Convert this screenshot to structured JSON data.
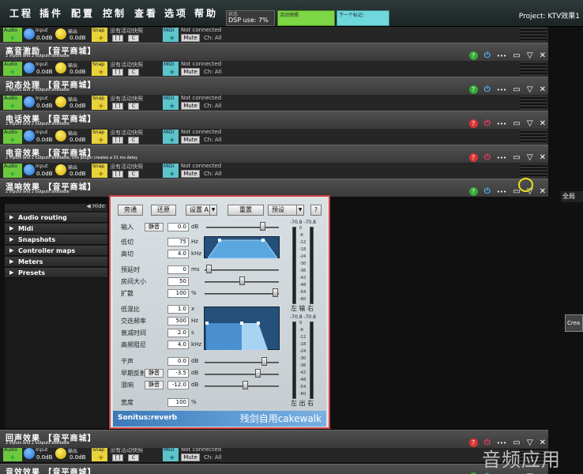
{
  "menu": {
    "items": [
      "工程",
      "插件",
      "配置",
      "控制",
      "查看",
      "选项",
      "帮助"
    ],
    "dsp_small": "状态",
    "dsp": "DSP use: 7%",
    "snap_label": "活动快照",
    "next_label": "下一个标记:",
    "project": "Project: KTV效果1"
  },
  "strip_ctrl": {
    "audio": "Audio",
    "input": "Input",
    "output": "输出",
    "db_in": "0.0dB",
    "db_out": "0.0dB",
    "snap": "Snap",
    "no_snap": "没有活动快照",
    "midi": "MIDI",
    "not_connected": "Not connected",
    "mute": "Mute",
    "ch": "Ch: All",
    "btn_a": "[ ]",
    "btn_b": "C"
  },
  "strips": [
    {
      "title": "高音激励 【音平商城】",
      "sub": "2 inputs and 2 outputs available"
    },
    {
      "title": "动态处理 【音平商城】",
      "sub": "2 inputs and 2 outputs available"
    },
    {
      "title": "电话效果 【音平商城】",
      "sub": "2 inputs and 2 outputs available"
    },
    {
      "title": "电音效果 【音平商城】",
      "sub": "2 inputs and 2 outputs available, this plugin creates a 31 ms delay"
    },
    {
      "title": "混响效果 【音平商城】",
      "sub": "2 inputs and 2 outputs available"
    },
    {
      "title": "回声效果 【音平商城】",
      "sub": "2 inputs and 2 outputs available"
    },
    {
      "title": "音效效果 【音平商城】",
      "sub": ""
    }
  ],
  "sidebar": {
    "hide": "Hide",
    "items": [
      "Audio routing",
      "Midi",
      "Snapshots",
      "Controller maps",
      "Meters",
      "Presets"
    ]
  },
  "right_panel": {
    "tab": "全局",
    "button": "Crea"
  },
  "reverb": {
    "buttons": [
      "旁通",
      "还原",
      "设置 A",
      "重置",
      "预设",
      "?"
    ],
    "input_label": "输入",
    "mute": "静音",
    "input_val": "0.0",
    "db": "dB",
    "params1": [
      {
        "label": "低切",
        "val": "75",
        "unit": "Hz"
      },
      {
        "label": "高切",
        "val": "4.0",
        "unit": "kHz"
      },
      {
        "label": "预延时",
        "val": "0",
        "unit": "ms"
      },
      {
        "label": "房间大小",
        "val": "50",
        "unit": ""
      },
      {
        "label": "扩散",
        "val": "100",
        "unit": "%"
      }
    ],
    "params2": [
      {
        "label": "低混比",
        "val": "1.0",
        "unit": "x"
      },
      {
        "label": "交迭频率",
        "val": "500",
        "unit": "Hz"
      },
      {
        "label": "衰减时间",
        "val": "2.0",
        "unit": "s"
      },
      {
        "label": "高频阻尼",
        "val": "4.0",
        "unit": "kHz"
      }
    ],
    "mix": [
      {
        "label": "干声",
        "val": "0.0",
        "unit": "dB"
      },
      {
        "label": "早期反射",
        "val": "-3.5",
        "unit": "dB"
      },
      {
        "label": "混响",
        "val": "-12.0",
        "unit": "dB"
      }
    ],
    "width_label": "宽度",
    "width_val": "100",
    "width_unit": "%",
    "meter_top": "-70.8 -70.8",
    "meter_top2": "-70.8 -70.8",
    "meter_lr1": "左 输 右",
    "meter_lr2": "左 出 右",
    "scale": [
      "0",
      "-6",
      "-12",
      "-18",
      "-24",
      "-30",
      "-36",
      "-42",
      "-48",
      "-54",
      "-60"
    ],
    "brand": "Sonitus:reverb",
    "cake": "残剑自用cakewalk"
  },
  "watermark": "音频应用"
}
